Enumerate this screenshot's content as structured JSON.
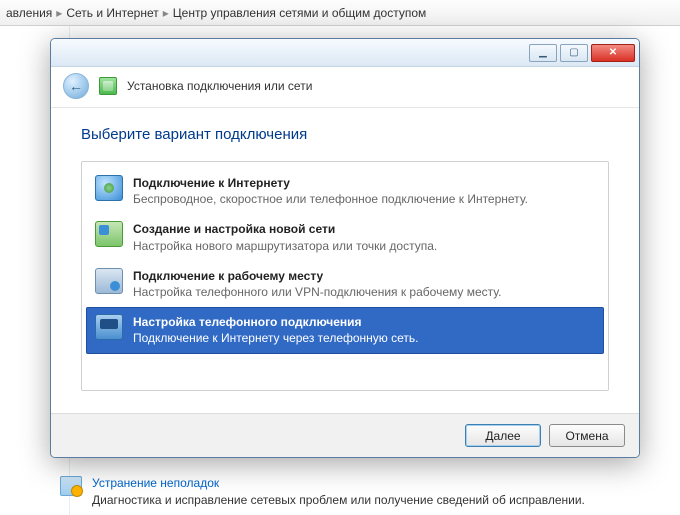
{
  "breadcrumb": {
    "seg0": "авления",
    "seg1": "Сеть и Интернет",
    "seg2": "Центр управления сетями и общим доступом"
  },
  "wizard": {
    "title_line": "Установка подключения или сети",
    "heading": "Выберите вариант подключения",
    "options": [
      {
        "title": "Подключение к Интернету",
        "sub": "Беспроводное, скоростное или телефонное подключение к Интернету."
      },
      {
        "title": "Создание и настройка новой сети",
        "sub": "Настройка нового маршрутизатора или точки доступа."
      },
      {
        "title": "Подключение к рабочему месту",
        "sub": "Настройка телефонного или VPN-подключения к рабочему месту."
      },
      {
        "title": "Настройка телефонного подключения",
        "sub": "Подключение к Интернету через телефонную сеть."
      }
    ],
    "buttons": {
      "next": "Далее",
      "cancel": "Отмена"
    }
  },
  "troubleshoot": {
    "link": "Устранение неполадок",
    "sub": "Диагностика и исправление сетевых проблем или получение сведений об исправлении."
  }
}
